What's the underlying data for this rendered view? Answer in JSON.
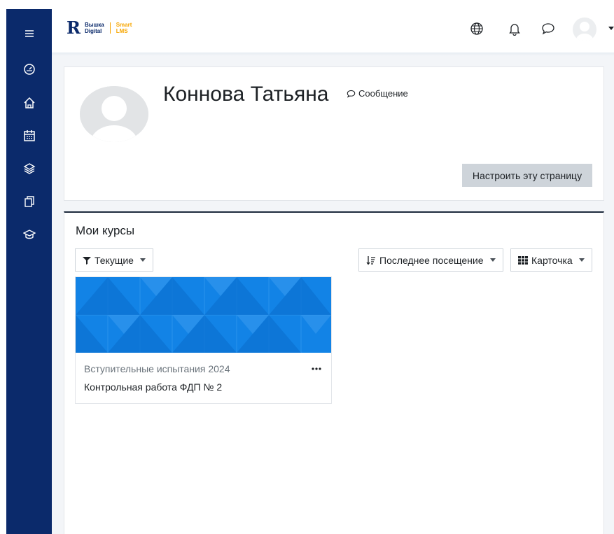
{
  "header": {
    "logo": {
      "line1": "Вышка",
      "line2": "Digital",
      "product1": "Smart",
      "product2": "LMS"
    },
    "icons": [
      "globe-icon",
      "bell-icon",
      "chat-icon",
      "avatar"
    ]
  },
  "sidebar": {
    "items": [
      {
        "icon": "menu-icon"
      },
      {
        "icon": "dashboard-icon"
      },
      {
        "icon": "home-icon"
      },
      {
        "icon": "calendar-icon"
      },
      {
        "icon": "layers-icon"
      },
      {
        "icon": "files-icon"
      },
      {
        "icon": "graduation-cap-icon"
      }
    ],
    "color": "#0b2a6b"
  },
  "profile": {
    "name": "Коннова Татьяна",
    "message_label": "Сообщение",
    "customize_button": "Настроить эту страницу"
  },
  "courses": {
    "title": "Мои курсы",
    "filter_label": "Текущие",
    "sort_label": "Последнее посещение",
    "view_label": "Карточка",
    "items": [
      {
        "category": "Вступительные испытания 2024",
        "name": "Контрольная работа ФДП № 2"
      }
    ]
  },
  "colors": {
    "accent": "#0f7fe3",
    "brand": "#0b2a6b",
    "logo_accent": "#f7a600"
  }
}
